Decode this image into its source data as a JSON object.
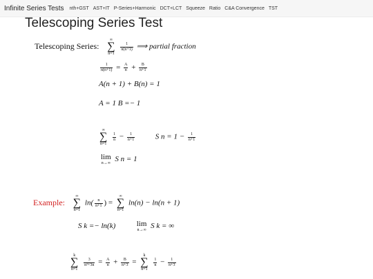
{
  "nav": {
    "brand": "Infinite Series Tests",
    "links": [
      "nth+GST",
      "AST+IT",
      "P-Series+Harmonic",
      "DCT+LCT",
      "Squeeze",
      "Ratio",
      "C&A Convergence",
      "TST"
    ]
  },
  "page_title": "Telescoping Series Test",
  "section": {
    "label": "Telescoping Series:",
    "arrow_text": "⟹ partial fraction",
    "sum_upper": "∞",
    "sum_lower": "n=1",
    "frac_num": "1",
    "frac_den": "n(n+1)"
  },
  "steps": {
    "pf_num": "1",
    "pf_den": "n(n+1)",
    "pf_a_num": "A",
    "pf_a_den": "n",
    "pf_b_num": "B",
    "pf_b_den": "n+1",
    "eq1": "A(n + 1) + B(n) = 1",
    "eq2": "A = 1 B =− 1",
    "sum_upper": "∞",
    "sum_lower": "n=1",
    "t1_num": "1",
    "t1_den": "n",
    "t2_num": "1",
    "t2_den": "n+1",
    "partial_sum_lhs": "S n = 1 −",
    "ps_num": "1",
    "ps_den": "n+1",
    "limit_text": "lim",
    "limit_sub": "n→∞",
    "limit_result": "S n = 1"
  },
  "example": {
    "label": "Example:",
    "sum_upper": "∞",
    "sum_lower": "n=1",
    "ln_open": "ln(",
    "ln_num": "n",
    "ln_den": "n+1",
    "ln_close": ") =",
    "rhs": "ln(n) − ln(n + 1)",
    "sk": "S k =− ln(k)",
    "limit_text": "lim",
    "limit_sub": "n→∞",
    "limit_result": "S k = ∞",
    "sum2_upper": "k",
    "sum2_lower": "n=1",
    "e_num": "3",
    "e_den": "n²+3n",
    "a_num": "A",
    "a_den": "n",
    "b_num": "B",
    "b_den": "n+3",
    "f1_num": "1",
    "f1_den": "n",
    "f2_num": "1",
    "f2_den": "n+3"
  }
}
